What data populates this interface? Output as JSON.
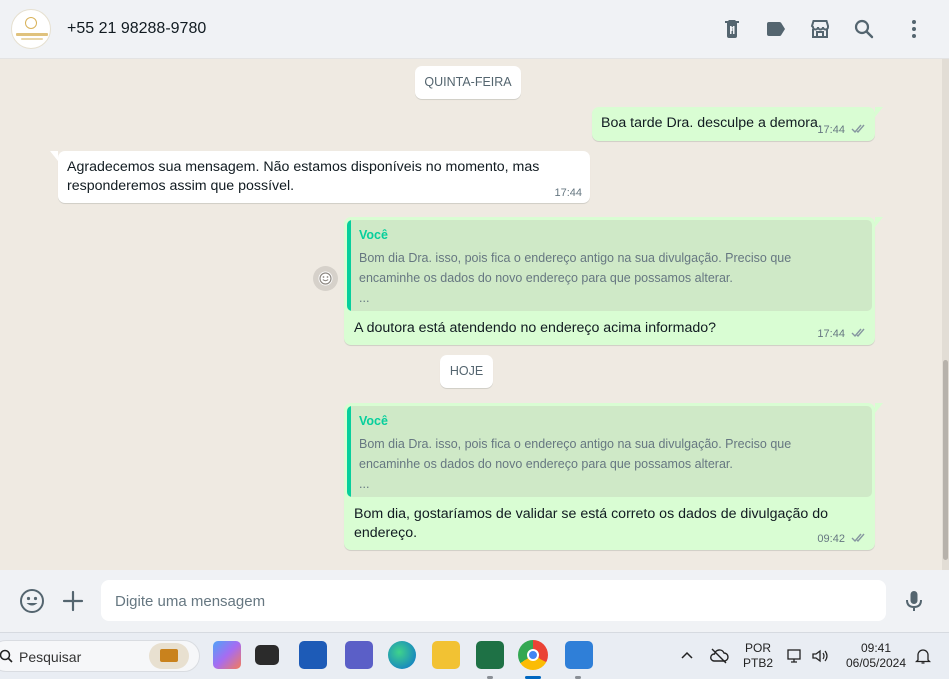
{
  "header": {
    "contact": "+55 21 98288-9780",
    "icons": [
      "delete-icon",
      "label-icon",
      "store-icon",
      "search-icon",
      "more-icon"
    ]
  },
  "chat": {
    "date_thursday": "QUINTA-FEIRA",
    "date_today": "HOJE",
    "messages": [
      {
        "text": "Boa tarde Dra. desculpe a demora.",
        "time": "17:44"
      },
      {
        "text": "Agradecemos sua mensagem. Não estamos disponíveis no momento, mas responderemos assim que possível.",
        "time": "17:44"
      },
      {
        "quote_author": "Você",
        "quote_text": "Bom dia Dra. isso, pois fica o endereço antigo na sua divulgação. Preciso que encaminhe os dados do novo endereço para que possamos alterar.",
        "quote_ellipsis": "...",
        "text": "A doutora está atendendo no endereço acima informado?",
        "time": "17:44"
      },
      {
        "quote_author": "Você",
        "quote_text": "Bom dia Dra. isso, pois fica o endereço antigo na sua divulgação. Preciso que encaminhe os dados do novo endereço para que possamos alterar.",
        "quote_ellipsis": "...",
        "text": "Bom dia, gostaríamos de validar se está correto os dados de divulgação do endereço.",
        "time": "09:42"
      }
    ]
  },
  "composer": {
    "placeholder": "Digite uma mensagem"
  },
  "taskbar": {
    "search_label": "Pesquisar",
    "lang_top": "POR",
    "lang_bottom": "PTB2",
    "time": "09:41",
    "date": "06/05/2024"
  },
  "colors": {
    "outgoing": "#d9fdd3",
    "incoming": "#ffffff",
    "accent": "#06cf9c",
    "chat_bg": "#efeae2"
  }
}
